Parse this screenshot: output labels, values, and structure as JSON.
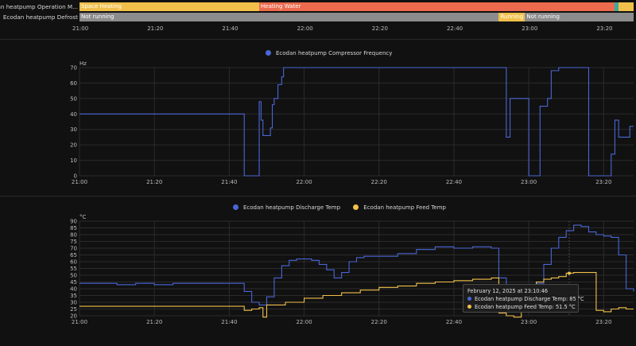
{
  "timelines": [
    {
      "label": "Ecodan heatpump Operation M...",
      "segments": [
        {
          "label": "Space Heating",
          "start": "21:00",
          "end": "21:48",
          "color": "#f1c04a"
        },
        {
          "label": "Heating Water",
          "start": "21:48",
          "end": "23:23",
          "color": "#ec6a4e"
        },
        {
          "label": "",
          "start": "23:23",
          "end": "23:24",
          "color": "#3aa7a0"
        },
        {
          "label": "",
          "start": "23:24",
          "end": "23:28",
          "color": "#f1c04a"
        }
      ]
    },
    {
      "label": "Ecodan heatpump Defrost",
      "segments": [
        {
          "label": "Not running",
          "start": "21:00",
          "end": "22:52",
          "color": "#8c8c8c"
        },
        {
          "label": "Running",
          "start": "22:52",
          "end": "22:59",
          "color": "#f1c04a"
        },
        {
          "label": "Not running",
          "start": "22:59",
          "end": "23:28",
          "color": "#8c8c8c"
        }
      ]
    }
  ],
  "time_ticks": [
    "21:00",
    "21:20",
    "21:40",
    "22:00",
    "22:20",
    "22:40",
    "23:00",
    "23:20"
  ],
  "chart_data": [
    {
      "type": "line",
      "legend_position": "top-center",
      "ylabel": "Hz",
      "ylim": [
        0,
        70
      ],
      "yticks": [
        0,
        10,
        20,
        30,
        40,
        50,
        60,
        70
      ],
      "xlim": [
        "21:00",
        "23:28"
      ],
      "series": [
        {
          "name": "Ecodan heatpump Compressor Frequency",
          "color": "#4a66d6",
          "step": true,
          "x": [
            "21:00",
            "21:44",
            "21:45",
            "21:48",
            "21:48.5",
            "21:49",
            "21:51",
            "21:51.5",
            "21:52",
            "21:53",
            "21:54",
            "21:54.5",
            "21:55",
            "22:54",
            "22:55",
            "22:56",
            "23:00",
            "23:02",
            "23:03",
            "23:04",
            "23:05",
            "23:06",
            "23:08",
            "23:09",
            "23:11",
            "23:16",
            "23:21",
            "23:22",
            "23:23",
            "23:24",
            "23:25",
            "23:27",
            "23:28"
          ],
          "values": [
            40,
            0,
            0,
            48,
            36,
            26,
            31,
            46,
            50,
            59,
            64,
            70,
            70,
            25,
            50,
            50,
            0,
            0,
            45,
            45,
            50,
            68,
            70,
            70,
            70,
            0,
            0,
            14,
            36,
            25,
            25,
            32,
            32
          ]
        }
      ]
    },
    {
      "type": "line",
      "legend_position": "top-center",
      "ylabel": "°C",
      "ylim": [
        20,
        90
      ],
      "yticks": [
        20,
        25,
        30,
        35,
        40,
        45,
        50,
        55,
        60,
        65,
        70,
        75,
        80,
        85,
        90
      ],
      "xlim": [
        "21:00",
        "23:28"
      ],
      "series": [
        {
          "name": "Ecodan heatpump Discharge Temp",
          "color": "#4a66d6",
          "step": true,
          "x": [
            "21:00",
            "21:05",
            "21:10",
            "21:15",
            "21:20",
            "21:25",
            "21:30",
            "21:35",
            "21:40",
            "21:44",
            "21:46",
            "21:48",
            "21:50",
            "21:52",
            "21:54",
            "21:56",
            "21:58",
            "22:00",
            "22:02",
            "22:04",
            "22:06",
            "22:08",
            "22:10",
            "22:12",
            "22:14",
            "22:16",
            "22:20",
            "22:25",
            "22:30",
            "22:35",
            "22:40",
            "22:45",
            "22:50",
            "22:52",
            "22:54",
            "22:56",
            "22:58",
            "23:00",
            "23:02",
            "23:04",
            "23:06",
            "23:08",
            "23:10",
            "23:12",
            "23:14",
            "23:16",
            "23:18",
            "23:20",
            "23:22",
            "23:24",
            "23:26",
            "23:28"
          ],
          "values": [
            44,
            44,
            43,
            44,
            43,
            44,
            44,
            44,
            44,
            38,
            30,
            28,
            34,
            48,
            57,
            61,
            62,
            62,
            61,
            58,
            54,
            48,
            52,
            60,
            63,
            64,
            64,
            66,
            69,
            71,
            70,
            71,
            70,
            48,
            42,
            40,
            38,
            43,
            44,
            58,
            70,
            78,
            83,
            87,
            86,
            82,
            80,
            79,
            78,
            65,
            40,
            38
          ]
        },
        {
          "name": "Ecodan heatpump Feed Temp",
          "color": "#f1c04a",
          "step": true,
          "x": [
            "21:00",
            "21:10",
            "21:20",
            "21:30",
            "21:40",
            "21:44",
            "21:46",
            "21:48",
            "21:49",
            "21:50",
            "21:55",
            "22:00",
            "22:05",
            "22:10",
            "22:15",
            "22:20",
            "22:25",
            "22:30",
            "22:35",
            "22:40",
            "22:45",
            "22:50",
            "22:52",
            "22:54",
            "22:56",
            "22:58",
            "23:00",
            "23:02",
            "23:04",
            "23:06",
            "23:08",
            "23:10",
            "23:12",
            "23:14",
            "23:16",
            "23:18",
            "23:20",
            "23:22",
            "23:24",
            "23:26",
            "23:28"
          ],
          "values": [
            27,
            27,
            27,
            27,
            27,
            24,
            25,
            26,
            19,
            28,
            30,
            33,
            35,
            37,
            39,
            41,
            42,
            44,
            45,
            46,
            47,
            48,
            22,
            20,
            19,
            40,
            42,
            45,
            47,
            48,
            49,
            51.5,
            52,
            52,
            52,
            24,
            23,
            25,
            26,
            25,
            25
          ]
        }
      ]
    }
  ],
  "tooltip": {
    "title": "February 12, 2025 at 23:10:46",
    "lines": [
      {
        "text": "Ecodan heatpump Discharge Temp: 85 °C",
        "color": "#4a66d6"
      },
      {
        "text": "Ecodan heatpump Feed Temp: 51.5 °C",
        "color": "#f1c04a"
      }
    ]
  }
}
